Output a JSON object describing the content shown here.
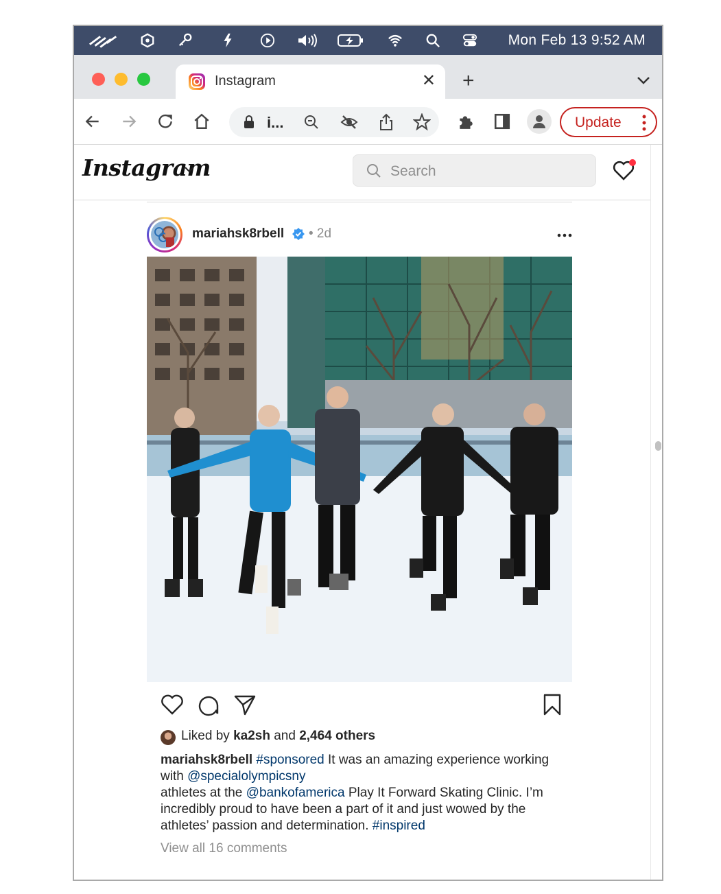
{
  "menubar": {
    "icons": [
      "bank-icon",
      "hexagon-icon",
      "key-icon",
      "bolt-icon",
      "play-icon",
      "volume-icon",
      "battery-icon",
      "wifi-icon",
      "search-icon",
      "control-center-icon"
    ],
    "clock": "Mon Feb 13  9:52 AM"
  },
  "tab": {
    "title": "Instagram",
    "favicon": "instagram-icon"
  },
  "toolbar": {
    "url": "i...",
    "update_label": "Update",
    "colors": {
      "update": "#c5221f"
    }
  },
  "instagram": {
    "logo": "Instagram",
    "search_placeholder": "Search"
  },
  "post": {
    "username": "mariahsk8rbell",
    "time": "• 2d",
    "liked_by": "Liked by",
    "liked_user": "ka2sh",
    "liked_and": "and",
    "liked_others": "2,464 others",
    "caption": {
      "user": "mariahsk8rbell",
      "hashtag1": "#sponsored",
      "text1": " It was an amazing experience working with ",
      "mention1": "@specialolympicsny",
      "text2": "athletes at the ",
      "mention2": "@bankofamerica",
      "text3": " Play It Forward Skating Clinic. I’m incredibly proud to have been a part of it and just wowed by the athletes’ passion and determination. ",
      "hashtag2": "#inspired"
    },
    "view_comments": "View all 16 comments"
  }
}
